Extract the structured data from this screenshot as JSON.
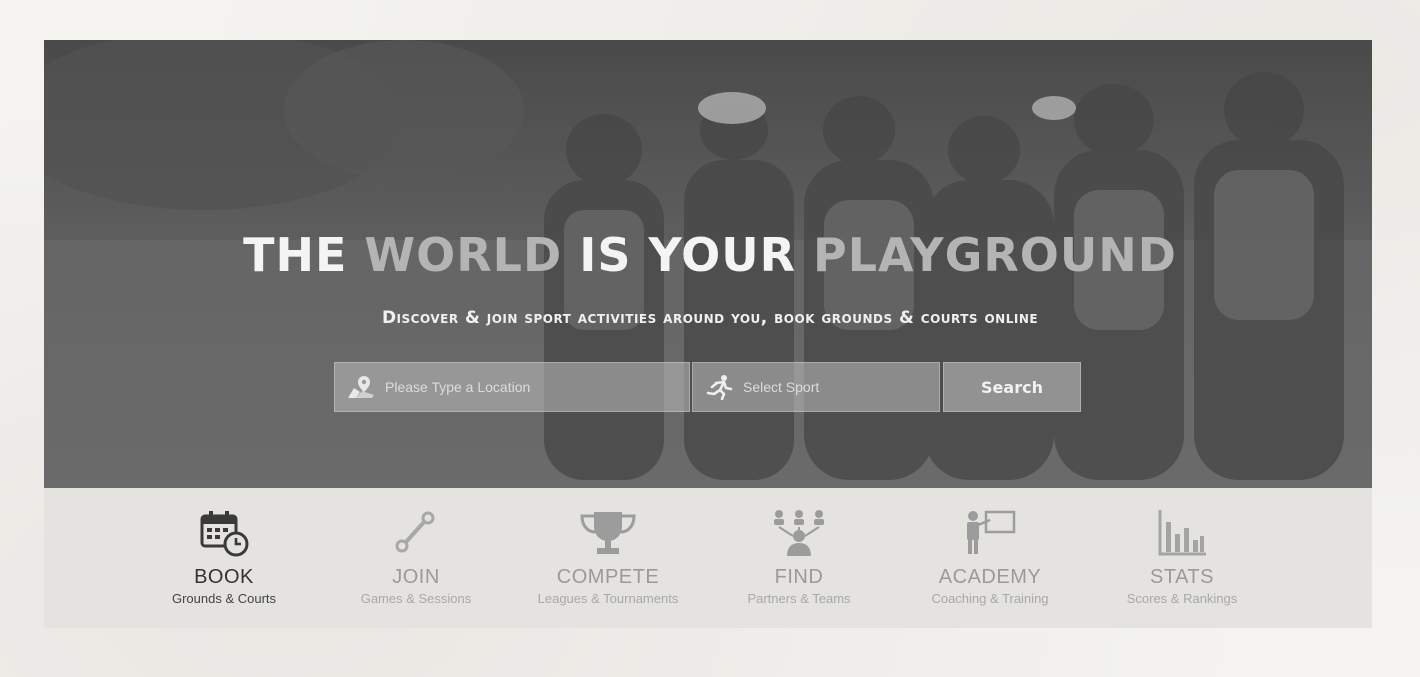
{
  "hero": {
    "headline": [
      {
        "text": "THE ",
        "tone": "light"
      },
      {
        "text": "WORLD ",
        "tone": "grey"
      },
      {
        "text": "IS YOUR ",
        "tone": "light"
      },
      {
        "text": "PLAYGROUND",
        "tone": "grey"
      }
    ],
    "subline": "Discover & join sport activities around you, book grounds & courts online"
  },
  "search": {
    "location_placeholder": "Please Type a Location",
    "location_icon": "map-pin-icon",
    "sport_placeholder": "Select Sport",
    "sport_icon": "runner-icon",
    "button_label": "Search"
  },
  "features": [
    {
      "title": "BOOK",
      "caption": "Grounds & Courts",
      "icon": "calendar-clock-icon",
      "active": true
    },
    {
      "title": "JOIN",
      "caption": "Games & Sessions",
      "icon": "link-icon",
      "active": false
    },
    {
      "title": "COMPETE",
      "caption": "Leagues & Tournaments",
      "icon": "trophy-icon",
      "active": false
    },
    {
      "title": "FIND",
      "caption": "Partners & Teams",
      "icon": "people-network-icon",
      "active": false
    },
    {
      "title": "ACADEMY",
      "caption": "Coaching & Training",
      "icon": "teacher-board-icon",
      "active": false
    },
    {
      "title": "STATS",
      "caption": "Scores & Rankings",
      "icon": "bar-chart-icon",
      "active": false
    }
  ]
}
